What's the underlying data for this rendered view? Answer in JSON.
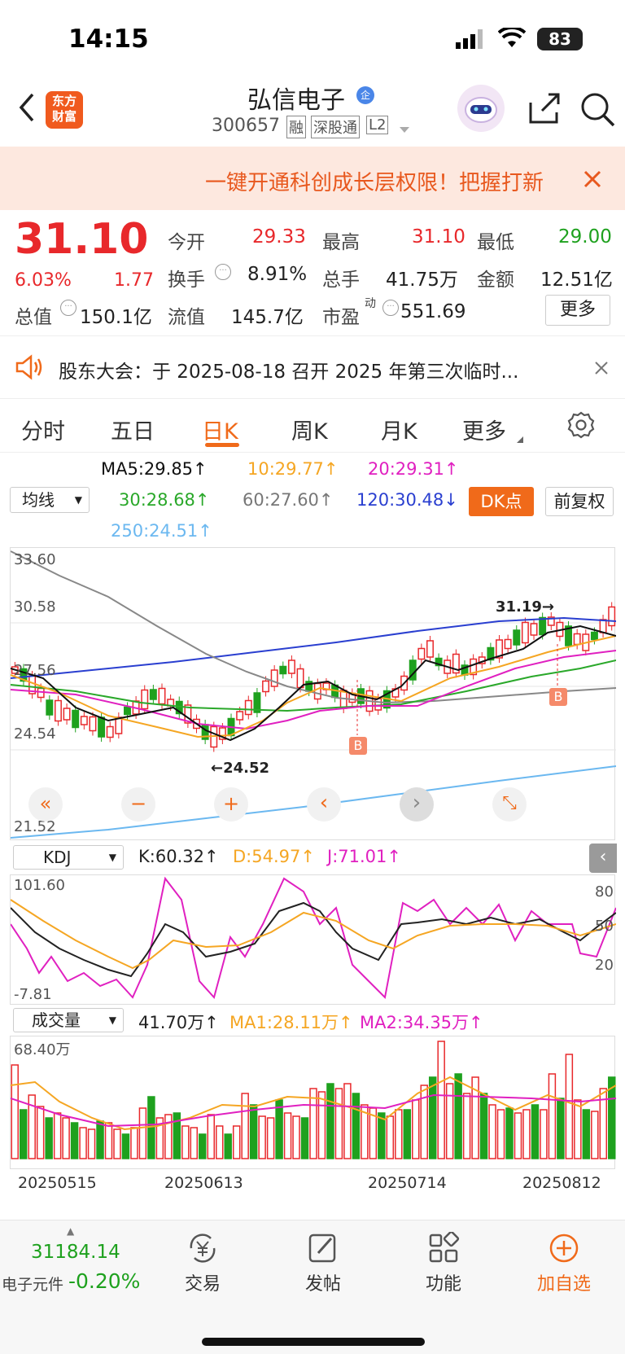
{
  "status_bar": {
    "time": "14:15",
    "battery": "83"
  },
  "header": {
    "logo_line1": "东方",
    "logo_line2": "财富",
    "title": "弘信电子",
    "verified_badge": "企",
    "code": "300657",
    "tags": [
      "融",
      "深股通",
      "L2"
    ]
  },
  "banner": {
    "text": "一键开通科创成长层权限！把握打新"
  },
  "quote": {
    "price": "31.10",
    "change_pct": "6.03%",
    "change_amt": "1.77",
    "fields": [
      {
        "label": "今开",
        "value": "29.33"
      },
      {
        "label": "最高",
        "value": "31.10"
      },
      {
        "label": "最低",
        "value": "29.00"
      },
      {
        "label": "换手",
        "value": "8.91%"
      },
      {
        "label": "总手",
        "value": "41.75万"
      },
      {
        "label": "金额",
        "value": "12.51亿"
      },
      {
        "label": "总值",
        "value": "150.1亿"
      },
      {
        "label": "流值",
        "value": "145.7亿"
      },
      {
        "label": "市盈",
        "sup": "动",
        "value": "551.69"
      }
    ],
    "more_label": "更多"
  },
  "notice": {
    "text": "股东大会：于 2025-08-18 召开 2025 年第三次临时..."
  },
  "tabs": [
    "分时",
    "五日",
    "日K",
    "周K",
    "月K",
    "更多"
  ],
  "active_tab": "日K",
  "ma_bar": {
    "selector": "均线",
    "ma5": "MA5:29.85↑",
    "ma10": "10:29.77↑",
    "ma20": "20:29.31↑",
    "ma30": "30:28.68↑",
    "ma60": "60:27.60↑",
    "ma120": "120:30.48↓",
    "ma250": "250:24.51↑",
    "dk_label": "DK点",
    "fuquan_label": "前复权"
  },
  "kline": {
    "y_labels": [
      "33.60",
      "30.58",
      "27.56",
      "24.54",
      "21.52"
    ],
    "high_mark": "31.19→",
    "low_mark": "←24.52",
    "b_marker": "B",
    "controls": [
      "«",
      "−",
      "+",
      "‹",
      "›",
      "⤡"
    ]
  },
  "kdj": {
    "selector": "KDJ",
    "k": "K:60.32↑",
    "d": "D:54.97↑",
    "j": "J:71.01↑",
    "y_top": "101.60",
    "y_bottom": "-7.81",
    "right_ticks": [
      "80",
      "50",
      "20"
    ]
  },
  "volume": {
    "selector": "成交量",
    "vol": "41.70万↑",
    "ma1": "MA1:28.11万↑",
    "ma2": "MA2:34.35万↑",
    "y_top": "68.40万"
  },
  "dates": [
    "20250515",
    "20250613",
    "20250714",
    "20250812"
  ],
  "bottom_nav": {
    "index_value": "31184.14",
    "index_name": "电子元件",
    "index_change": "-0.20%",
    "items": [
      "交易",
      "发帖",
      "功能",
      "加自选"
    ]
  },
  "colors": {
    "up": "#e8282b",
    "down": "#1ea11e",
    "accent": "#f06a1a",
    "ma5": "#111111",
    "ma10": "#f5a623",
    "ma20": "#e020c0",
    "ma30": "#2aa82a",
    "ma60": "#888888",
    "ma120": "#2a3fd0",
    "ma250": "#6bb8f0"
  }
}
